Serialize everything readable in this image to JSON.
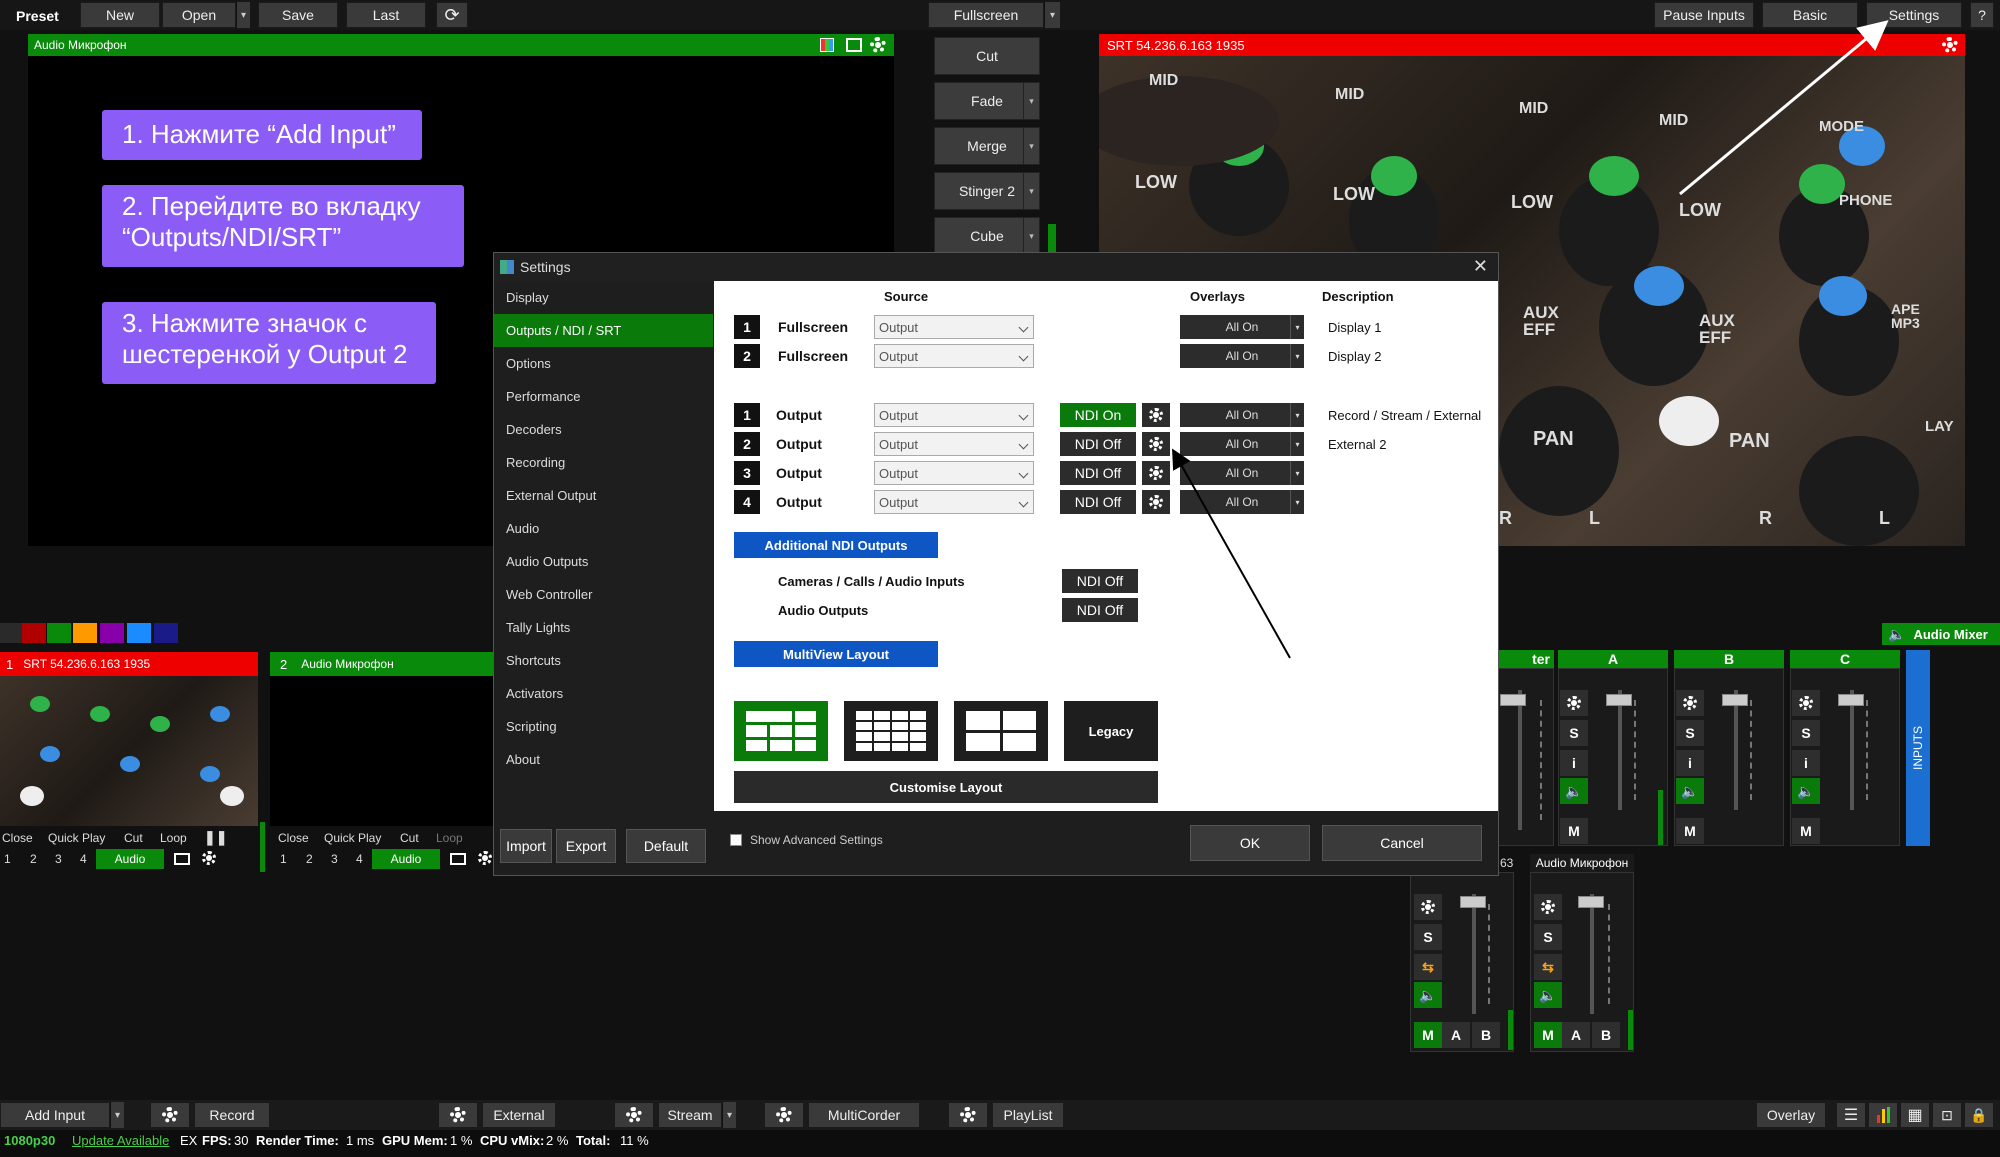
{
  "topbar": {
    "preset_label": "Preset",
    "new": "New",
    "open": "Open",
    "save": "Save",
    "last": "Last",
    "fullscreen": "Fullscreen",
    "pause_inputs": "Pause Inputs",
    "basic": "Basic",
    "settings": "Settings",
    "help": "?"
  },
  "preview": {
    "title": "Audio Микрофон"
  },
  "output": {
    "title": "SRT 54.236.6.163 1935"
  },
  "callouts": {
    "step1": "1.  Нажмите “Add Input”",
    "step2": "2. Перейдите во вкладку “Outputs/NDI/SRT”",
    "step3": "3. Нажмите значок с шестеренкой у Output 2"
  },
  "transitions": [
    "Cut",
    "Fade",
    "Merge",
    "Stinger 2",
    "Cube"
  ],
  "mixer_knob_labels": [
    "MID",
    "MID",
    "MID",
    "MID",
    "LOW",
    "LOW",
    "LOW",
    "LOW",
    "AUX EFF",
    "AUX EFF",
    "PAN",
    "PAN",
    "MODE",
    "PHONE",
    "APE MP3",
    "LAY",
    "R",
    "R",
    "L",
    "L"
  ],
  "inputs": [
    {
      "number": "1",
      "title": "SRT 54.236.6.163 1935",
      "close": "Close",
      "quick_play": "Quick Play",
      "cut": "Cut",
      "loop": "Loop",
      "nums": [
        "1",
        "2",
        "3",
        "4"
      ],
      "audio": "Audio"
    },
    {
      "number": "2",
      "title": "Audio Микрофон",
      "close": "Close",
      "quick_play": "Quick Play",
      "cut": "Cut",
      "loop": "Loop",
      "nums": [
        "1",
        "2",
        "3",
        "4"
      ],
      "audio": "Audio"
    }
  ],
  "swatch_colors": [
    "#2a2a2a",
    "#b00000",
    "#0a8a0a",
    "#ff9900",
    "#8800aa",
    "#1a8cff",
    "#1a1a88"
  ],
  "settings_dialog": {
    "title": "Settings",
    "nav": [
      "Display",
      "Outputs / NDI / SRT",
      "Options",
      "Performance",
      "Decoders",
      "Recording",
      "External Output",
      "Audio",
      "Audio Outputs",
      "Web Controller",
      "Tally Lights",
      "Shortcuts",
      "Activators",
      "Scripting",
      "About"
    ],
    "selected_nav": "Outputs / NDI / SRT",
    "headers": {
      "source": "Source",
      "overlays": "Overlays",
      "description": "Description"
    },
    "displays": [
      {
        "num": "1",
        "label": "Fullscreen",
        "source": "Output",
        "overlays": "All On",
        "description": "Display 1"
      },
      {
        "num": "2",
        "label": "Fullscreen",
        "source": "Output",
        "overlays": "All On",
        "description": "Display 2"
      }
    ],
    "outputs": [
      {
        "num": "1",
        "label": "Output",
        "source": "Output",
        "ndi": "NDI On",
        "overlays": "All On",
        "description": "Record / Stream / External"
      },
      {
        "num": "2",
        "label": "Output",
        "source": "Output",
        "ndi": "NDI Off",
        "overlays": "All On",
        "description": "External 2"
      },
      {
        "num": "3",
        "label": "Output",
        "source": "Output",
        "ndi": "NDI Off",
        "overlays": "All On",
        "description": ""
      },
      {
        "num": "4",
        "label": "Output",
        "source": "Output",
        "ndi": "NDI Off",
        "overlays": "All On",
        "description": ""
      }
    ],
    "additional_ndi": "Additional NDI Outputs",
    "cameras_label": "Cameras / Calls / Audio Inputs",
    "cameras_ndi": "NDI Off",
    "audio_outputs_label": "Audio Outputs",
    "audio_outputs_ndi": "NDI Off",
    "multiview": "MultiView Layout",
    "legacy": "Legacy",
    "customise": "Customise Layout",
    "import": "Import",
    "export": "Export",
    "default": "Default",
    "show_advanced": "Show Advanced Settings",
    "ok": "OK",
    "cancel": "Cancel"
  },
  "audio_mixer": {
    "title": "Audio Mixer",
    "master_partial": "ter",
    "buses": [
      "A",
      "B",
      "C"
    ],
    "inputs_tab": "INPUTS",
    "strip_label_partial": "63",
    "strip_label": "Audio Микрофон",
    "s": "S",
    "i": "i",
    "m": "M",
    "a": "A",
    "b": "B"
  },
  "bottombar": {
    "add_input": "Add Input",
    "record": "Record",
    "external": "External",
    "stream": "Stream",
    "multicorder": "MultiCorder",
    "playlist": "PlayList",
    "overlay": "Overlay"
  },
  "statusbar": {
    "resolution": "1080p30",
    "update": "Update Available",
    "ex": "EX",
    "fps_label": "FPS:",
    "fps": "30",
    "render_label": "Render Time:",
    "render": "1 ms",
    "gpu_label": "GPU Mem:",
    "gpu": "1 %",
    "cpu_label": "CPU vMix:",
    "cpu": "2 %",
    "total_label": "Total:",
    "total": "11 %"
  }
}
